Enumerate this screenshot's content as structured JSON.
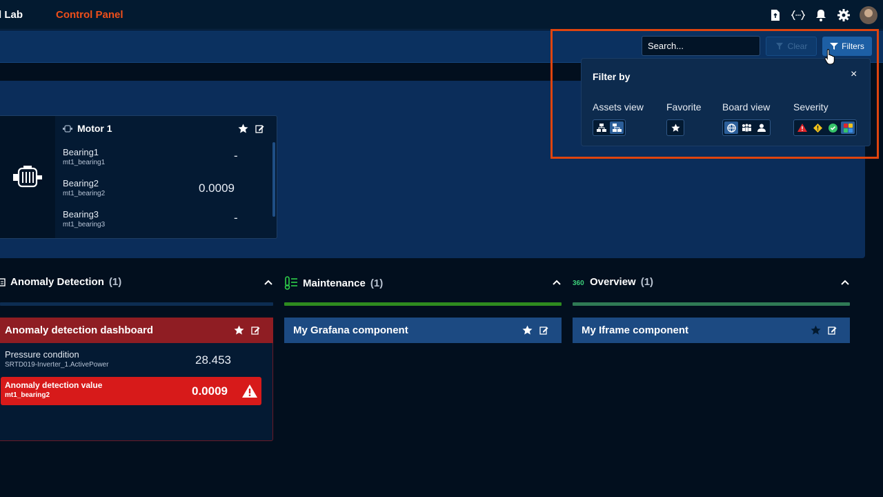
{
  "header": {
    "brand": "l Lab",
    "app_title": "Control Panel",
    "icons": [
      "document-icon",
      "code-braces-icon",
      "bell-icon",
      "gear-icon",
      "avatar"
    ]
  },
  "toolbar": {
    "search_placeholder": "Search...",
    "clear_label": "Clear",
    "filters_label": "Filters"
  },
  "filter_panel": {
    "title": "Filter by",
    "close_icon": "×",
    "groups": [
      {
        "label": "Assets view",
        "options": [
          "hierarchy-icon",
          "hierarchy-alt-icon"
        ],
        "active": 1
      },
      {
        "label": "Favorite",
        "options": [
          "star-icon"
        ],
        "active": -1
      },
      {
        "label": "Board view",
        "options": [
          "globe-icon",
          "group-icon",
          "person-icon"
        ],
        "active": 0
      },
      {
        "label": "Severity",
        "options": [
          "alert-triangle-icon",
          "warning-diamond-icon",
          "check-circle-icon",
          "grid-icon"
        ],
        "active": 3
      }
    ]
  },
  "motor_card": {
    "title": "Motor 1",
    "rows": [
      {
        "name": "Bearing1",
        "sub": "mt1_bearing1",
        "value": "-"
      },
      {
        "name": "Bearing2",
        "sub": "mt1_bearing2",
        "value": "0.0009"
      },
      {
        "name": "Bearing3",
        "sub": "mt1_bearing3",
        "value": "-"
      }
    ]
  },
  "sections": [
    {
      "title": "Anomaly Detection",
      "count": "(1)",
      "color": "#0d2d52"
    },
    {
      "title": "Maintenance",
      "count": "(1)",
      "color": "#2e8b1f"
    },
    {
      "title": "Overview",
      "count": "(1)",
      "color": "#2f7a55"
    }
  ],
  "anomaly_card": {
    "title": "Anomaly detection dashboard",
    "row1_name": "Pressure condition",
    "row1_sub": "SRTD019-Inverter_1.ActivePower",
    "row1_value": "28.453",
    "alert_name": "Anomaly detection value",
    "alert_sub": "mt1_bearing2",
    "alert_value": "0.0009"
  },
  "grafana_card": {
    "title": "My Grafana component"
  },
  "iframe_card": {
    "title": "My Iframe component"
  },
  "colors": {
    "accent": "#ef4f1a",
    "anomaly_header": "#8f1d23",
    "alert": "#d71a1a",
    "panel_header": "#1c4a82",
    "maintenance_bar": "#2e8b1f",
    "overview_bar": "#2f7a55"
  }
}
